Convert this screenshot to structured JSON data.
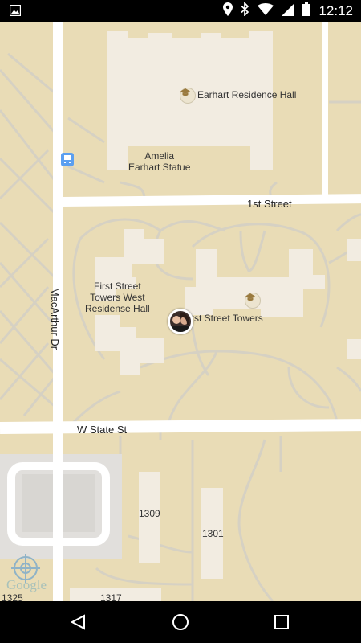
{
  "status_bar": {
    "time": "12:12"
  },
  "map": {
    "places": [
      {
        "id": "earhart",
        "label": "Earhart Residence Hall"
      },
      {
        "id": "statue",
        "label": "Amelia\nEarhart Statue"
      },
      {
        "id": "fstw",
        "label": "First Street\nTowers West\nResidense Hall"
      },
      {
        "id": "fst",
        "label": "First Street Towers"
      }
    ],
    "streets": {
      "first": "1st Street",
      "state": "W State St",
      "macarthur": "MacArthur Dr"
    },
    "building_numbers": [
      "1309",
      "1301",
      "1325",
      "1317"
    ],
    "attribution": "Google"
  },
  "colors": {
    "map_background": "#e9dcb6",
    "building": "#f2ece1",
    "road": "#ffffff",
    "path": "#d6d1c3"
  }
}
